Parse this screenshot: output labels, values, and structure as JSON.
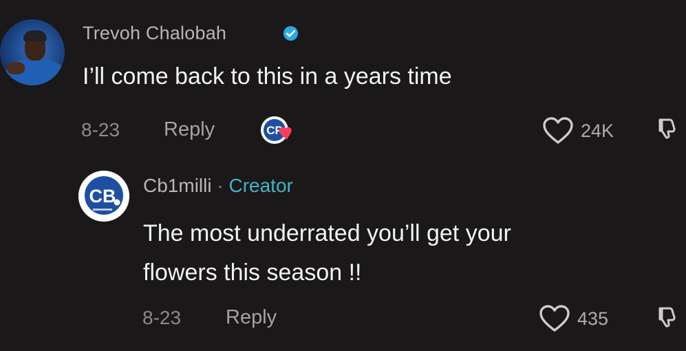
{
  "comment": {
    "author": "Trevoh Chalobah",
    "verified": true,
    "text": "I’ll come back to this in a years time",
    "date": "8-23",
    "reply_label": "Reply",
    "likes": "24K",
    "liked_by_creator": true
  },
  "reply": {
    "author": "Cb1milli",
    "separator": "·",
    "badge": "Creator",
    "text_line1": "The most underrated you’ll get your",
    "text_line2": "flowers this season !!",
    "date": "8-23",
    "reply_label": "Reply",
    "likes": "435"
  },
  "icons": {
    "verified": "verified-badge-icon",
    "heart": "heart-outline-icon",
    "dislike": "thumbs-down-icon",
    "creator_like": "creator-heart-icon",
    "logo_text": "CB"
  },
  "colors": {
    "background": "#1b1819",
    "verified_blue": "#29a9e8",
    "creator_badge": "#3fb6c9",
    "heart_red": "#ff3b5c",
    "logo_blue": "#1d4fa3"
  }
}
